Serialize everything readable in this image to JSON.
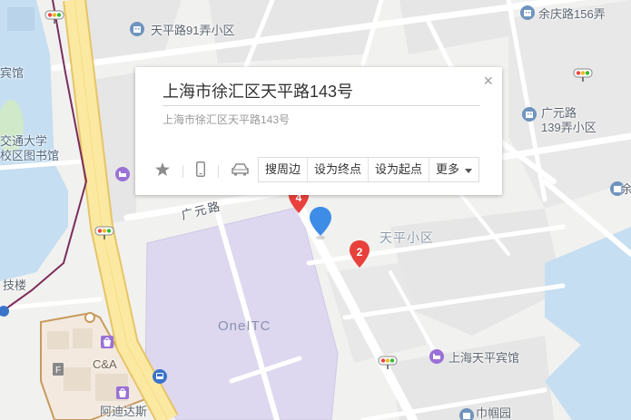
{
  "popup": {
    "title": "上海市徐汇区天平路143号",
    "address": "上海市徐汇区天平路143号",
    "actions": [
      "搜周边",
      "设为终点",
      "设为起点"
    ],
    "more_label": "更多"
  },
  "map_labels": {
    "tianping_91": "天平路91弄小区",
    "yuqing_156": "余庆路156弄",
    "guangyuan_139_line1": "广元路",
    "guangyuan_139_line2": "139弄小区",
    "binguan_left": "宾馆",
    "jiaotong_line1": "交通大学",
    "jiaotong_line2": "校区图书馆",
    "keji_lou": "技楼",
    "guangyuan_road": "广元路",
    "tianping_xiaoqu": "天平小区",
    "oneitc": "OneITC",
    "ca": "C&A",
    "tianping_hotel": "上海天平宾馆",
    "adidas": "阿迪达斯",
    "jinguo": "巾帼园",
    "edge_right": "余"
  },
  "markers": [
    {
      "label": "2"
    },
    {
      "label": "4"
    }
  ],
  "colors": {
    "background": "#f1f1ef",
    "block": "#e6e6e6",
    "road": "#ffffff",
    "major_road": "#fbe9a1",
    "major_road_edge": "#e7c468",
    "water": "#c6def1",
    "green": "#cfe9c9",
    "oneitc_block": "#ddd8ef",
    "marker_red": "#e8403b",
    "pin_blue": "#3d8de6",
    "poi_blue": "#6f94bd",
    "poi_purple": "#9a71d6"
  }
}
